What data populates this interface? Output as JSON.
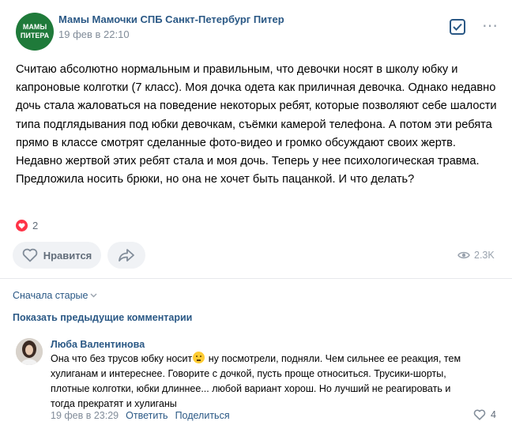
{
  "post": {
    "group_avatar_text": "МАМЫ ПИТЕРА",
    "group_name": "Мамы Мамочки СПБ Санкт-Петербург Питер",
    "time": "19 фев в 22:10",
    "text": "Считаю абсолютно нормальным и правильным, что девочки носят в школу юбку и капроновые колготки (7 класс). Моя дочка одета как приличная девочка. Однако недавно дочь стала жаловаться на поведение некоторых ребят, которые позволяют себе шалости типа подглядывания под юбки девочкам, съёмки камерой телефона. А потом эти ребята прямо в классе смотрят сделанные фото-видео и громко обсуждают своих жертв. Недавно жертвой этих ребят стала и моя дочь. Теперь у нее психологическая травма. Предложила носить брюки, но она не хочет быть пацанкой. И что делать?",
    "reaction_count": "2",
    "like_label": "Нравится",
    "views": "2.3K"
  },
  "comments_section": {
    "sort_label": "Сначала старые",
    "show_previous_label": "Показать предыдущие комментарии"
  },
  "comment": {
    "author": "Люба Валентинова",
    "text_before_emoji": "Она что без трусов юбку носит",
    "text_after_emoji": " ну посмотрели, подняли. Чем сильнее ее реакция, тем хулиганам и интереснее. Говорите с дочкой, пусть проще относиться. Трусики-шорты, плотные колготки, юбки длиннее... любой вариант хорош. Но лучший не реагировать и тогда прекратят и хулиганы",
    "time": "19 фев в 23:29",
    "reply_label": "Ответить",
    "share_label": "Поделиться",
    "likes": "4"
  },
  "colors": {
    "accent": "#2a5885",
    "heart": "#ff3347",
    "muted": "#818c99",
    "button_bg": "#f0f2f5"
  }
}
